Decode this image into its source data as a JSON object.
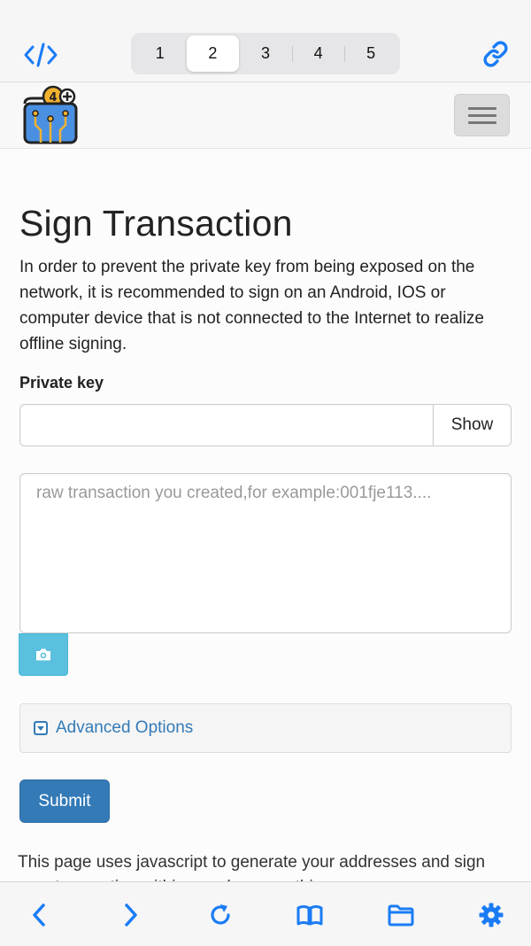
{
  "toolbar": {
    "tabs": [
      "1",
      "2",
      "3",
      "4",
      "5"
    ],
    "active_tab": "2",
    "accent_color": "#1a7cf5"
  },
  "navbar": {
    "logo_icon": "wallet-circuit-logo",
    "menu_icon": "hamburger-icon"
  },
  "page": {
    "title": "Sign Transaction",
    "description": "In order to prevent the private key from being exposed on the network, it is recommended to sign on an Android, IOS or computer device that is not connected to the Internet to realize offline signing.",
    "private_key_label": "Private key",
    "private_key_value": "",
    "show_button": "Show",
    "raw_tx_placeholder": "raw transaction you created,for example:001fje113....",
    "advanced_options": "Advanced Options",
    "submit_button": "Submit",
    "footer_text": "This page uses javascript to generate your addresses and sign your transaction within your browser, this means"
  },
  "bottombar": {
    "items": [
      "back-icon",
      "forward-icon",
      "reload-icon",
      "bookmarks-icon",
      "folder-icon",
      "settings-icon"
    ]
  }
}
